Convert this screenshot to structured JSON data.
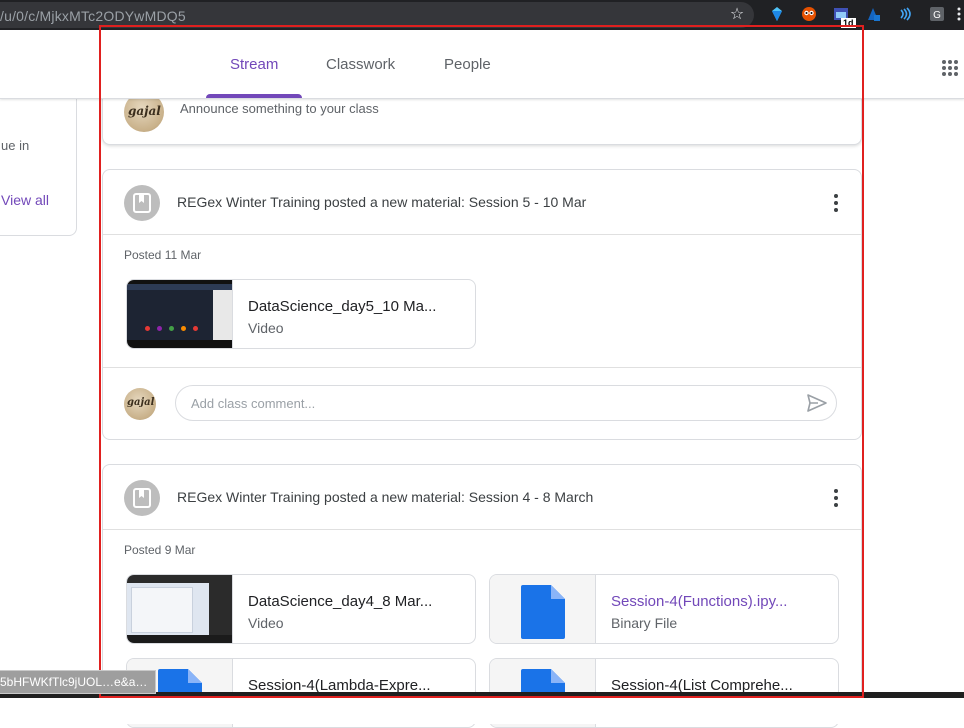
{
  "browser": {
    "url": "/u/0/c/MjkxMTc2ODYwMDQ5",
    "extensions": [
      "bookmark-star-icon",
      "gem-extension-icon",
      "owl-extension-icon",
      "calendar-extension-icon",
      "bitwarden-extension-icon",
      "wifi-extension-icon",
      "grammarly-extension-icon",
      "more-menu-icon"
    ],
    "badge": "1d",
    "status_link": "5bHFWKfTlc9jUOL…e&a…"
  },
  "header": {
    "tabs": [
      {
        "label": "Stream",
        "active": true
      },
      {
        "label": "Classwork",
        "active": false
      },
      {
        "label": "People",
        "active": false
      }
    ]
  },
  "sidebar": {
    "due_text": "ue in",
    "view_all": "View all"
  },
  "announce": {
    "placeholder": "Announce something to your class"
  },
  "posts": [
    {
      "title": "REGex Winter Training posted a new material: Session 5 - 10 Mar",
      "posted": "Posted 11 Mar",
      "attachments": [
        {
          "name": "DataScience_day5_10 Ma...",
          "type": "Video"
        }
      ],
      "comment_placeholder": "Add class comment..."
    },
    {
      "title": "REGex Winter Training posted a new material: Session 4 - 8 March",
      "posted": "Posted 9 Mar",
      "attachments": [
        {
          "name": "DataScience_day4_8 Mar...",
          "type": "Video"
        },
        {
          "name": "Session-4(Functions).ipy...",
          "type": "Binary File"
        },
        {
          "name": "Session-4(Lambda-Expre...",
          "type": ""
        },
        {
          "name": "Session-4(List Comprehe...",
          "type": ""
        }
      ]
    }
  ],
  "colors": {
    "accent": "#7248b9",
    "highlight": "#e0201f",
    "file_blue": "#1a73e8"
  }
}
